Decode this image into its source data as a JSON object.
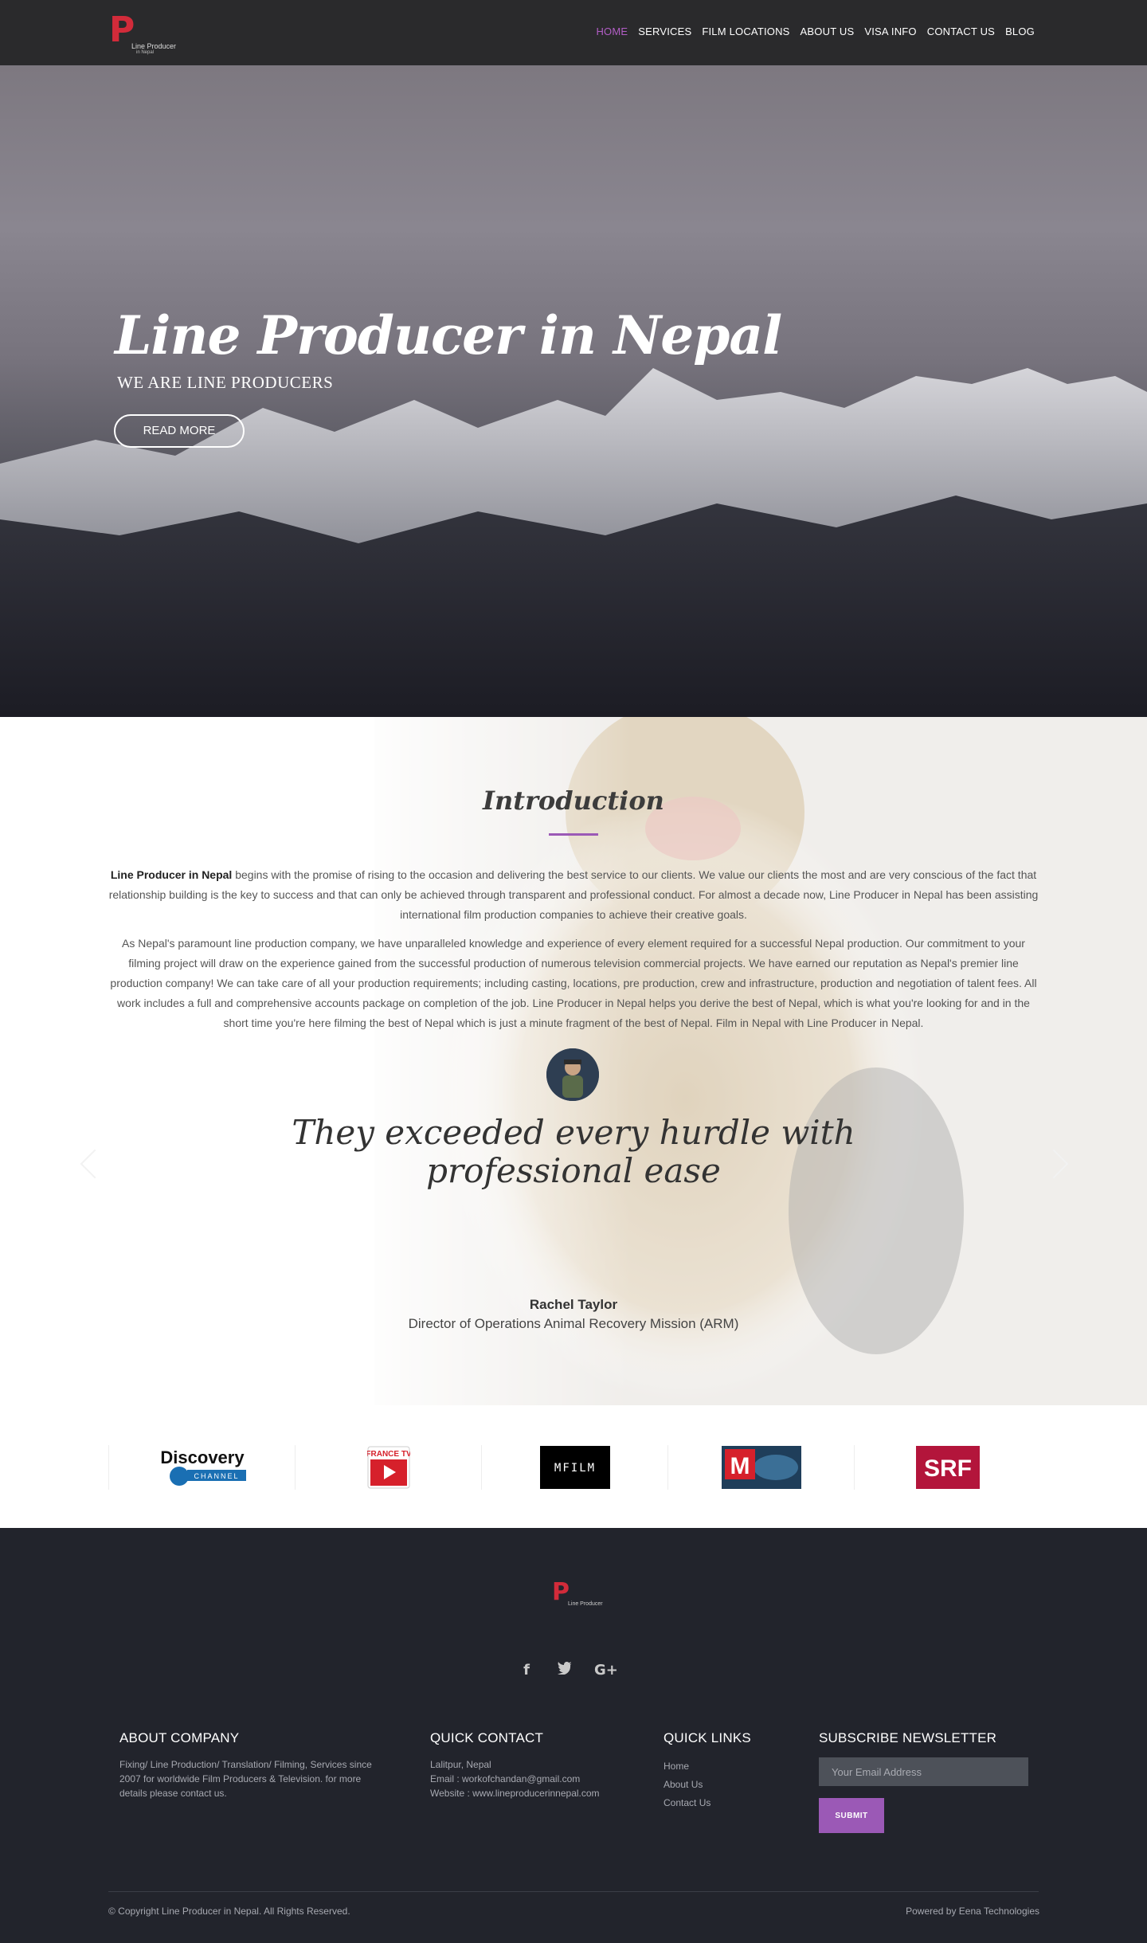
{
  "brand": {
    "logo_letter": "P",
    "logo_text": "Line Producer",
    "logo_subtext": "in Nepal",
    "accent_color": "#9b59b6",
    "logo_color": "#d22b3a"
  },
  "nav": {
    "items": [
      {
        "label": "HOME",
        "active": true
      },
      {
        "label": "SERVICES"
      },
      {
        "label": "FILM LOCATIONS"
      },
      {
        "label": "ABOUT US"
      },
      {
        "label": "VISA INFO"
      },
      {
        "label": "CONTACT US"
      },
      {
        "label": "BLOG"
      }
    ]
  },
  "hero": {
    "title": "Line Producer in Nepal",
    "subtitle": "WE ARE LINE PRODUCERS",
    "button": "READ MORE"
  },
  "intro": {
    "title": "Introduction",
    "p1_bold": "Line Producer in Nepal",
    "p1_rest": " begins with the promise of rising to the occasion and delivering the best service to our clients. We value our clients the most and are very conscious of the fact that relationship building is the key to success and that can only be achieved through transparent and professional conduct. For almost a decade now, Line Producer in Nepal has been assisting international film production companies to achieve their creative goals.",
    "p2": "As Nepal's paramount line production company, we have unparalleled knowledge and experience of every element required for a successful Nepal production. Our commitment to your filming project will draw on the experience gained from the successful production of numerous television commercial projects. We have earned our reputation as Nepal's premier line production company! We can take care of all your production requirements; including casting, locations, pre production, crew and infrastructure, production and negotiation of talent fees. All work includes a full and comprehensive accounts package on completion of the job. Line Producer in Nepal helps you derive the best of Nepal, which is what you're looking for and in the short time you're here filming the best of Nepal which is just a minute fragment of the best of Nepal. Film in Nepal with Line Producer in Nepal."
  },
  "testimonial": {
    "quote": "They exceeded every hurdle with professional ease",
    "name": "Rachel Taylor",
    "role": "Director of Operations Animal Recovery Mission (ARM)"
  },
  "clients": [
    {
      "name": "Discovery",
      "sub": "CHANNEL"
    },
    {
      "name": "FRANCE TV"
    },
    {
      "name": "MFILM"
    },
    {
      "name": "M"
    },
    {
      "name": "SRF"
    }
  ],
  "footer": {
    "logo_letter": "P",
    "logo_text": "Line Producer",
    "social": [
      "facebook-icon",
      "twitter-icon",
      "google-plus-icon"
    ],
    "about_head": "ABOUT COMPANY",
    "about_text": "Fixing/ Line Production/ Translation/ Filming, Services since 2007 for worldwide Film Producers & Television. for more details please contact us.",
    "contact_head": "QUICK CONTACT",
    "contact_lines": [
      "Lalitpur, Nepal",
      "Email : workofchandan@gmail.com",
      "Website : www.lineproducerinnepal.com"
    ],
    "links_head": "QUICK LINKS",
    "links": [
      "Home",
      "About Us",
      "Contact Us"
    ],
    "newsletter_head": "SUBSCRIBE NEWSLETTER",
    "email_placeholder": "Your Email Address",
    "submit": "SUBMIT",
    "copyright": "© Copyright Line Producer in Nepal. All Rights Reserved.",
    "powered": "Powered by Eena Technologies"
  }
}
